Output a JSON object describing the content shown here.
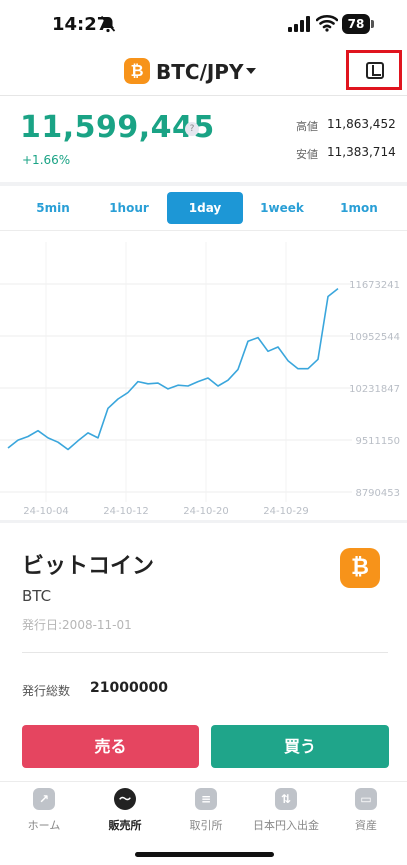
{
  "status_bar": {
    "time": "14:27",
    "battery": "78"
  },
  "header": {
    "coin_badge": "₿",
    "pair": "BTC/JPY"
  },
  "price": {
    "current": "11,599,445",
    "help": "?",
    "change": "+1.66%",
    "high_label": "高値",
    "high_value": "11,863,452",
    "low_label": "安値",
    "low_value": "11,383,714"
  },
  "tabs": [
    {
      "label": "5min",
      "active": false
    },
    {
      "label": "1hour",
      "active": false
    },
    {
      "label": "1day",
      "active": true
    },
    {
      "label": "1week",
      "active": false
    },
    {
      "label": "1mon",
      "active": false
    }
  ],
  "chart_data": {
    "type": "line",
    "y_ticks": [
      "11673241",
      "10952544",
      "10231847",
      "9511150",
      "8790453"
    ],
    "x_ticks": [
      "24-10-04",
      "24-10-12",
      "24-10-20",
      "24-10-29"
    ],
    "ylim": [
      8790453,
      11673241
    ],
    "color": "#3aa6dc",
    "values": [
      9400000,
      9510000,
      9560000,
      9640000,
      9540000,
      9480000,
      9380000,
      9500000,
      9610000,
      9540000,
      9950000,
      10080000,
      10170000,
      10320000,
      10290000,
      10300000,
      10220000,
      10270000,
      10260000,
      10320000,
      10370000,
      10260000,
      10340000,
      10490000,
      10880000,
      10930000,
      10740000,
      10800000,
      10610000,
      10500000,
      10500000,
      10630000,
      11500000,
      11610000
    ]
  },
  "coin": {
    "name": "ビットコイン",
    "symbol": "BTC",
    "icon": "₿",
    "issue_date": "発行日:2008-11-01",
    "supply_label": "発行総数",
    "supply_value": "21000000"
  },
  "actions": {
    "sell": "売る",
    "buy": "買う"
  },
  "nav": [
    {
      "label": "ホーム",
      "icon": "chart-icon",
      "glyph": "↗",
      "active": false
    },
    {
      "label": "販売所",
      "icon": "wave-icon",
      "glyph": "〜",
      "active": true
    },
    {
      "label": "取引所",
      "icon": "coins-icon",
      "glyph": "≡",
      "active": false
    },
    {
      "label": "日本円入出金",
      "icon": "transfer-icon",
      "glyph": "⇅",
      "active": false
    },
    {
      "label": "資産",
      "icon": "wallet-icon",
      "glyph": "▭",
      "active": false
    }
  ]
}
